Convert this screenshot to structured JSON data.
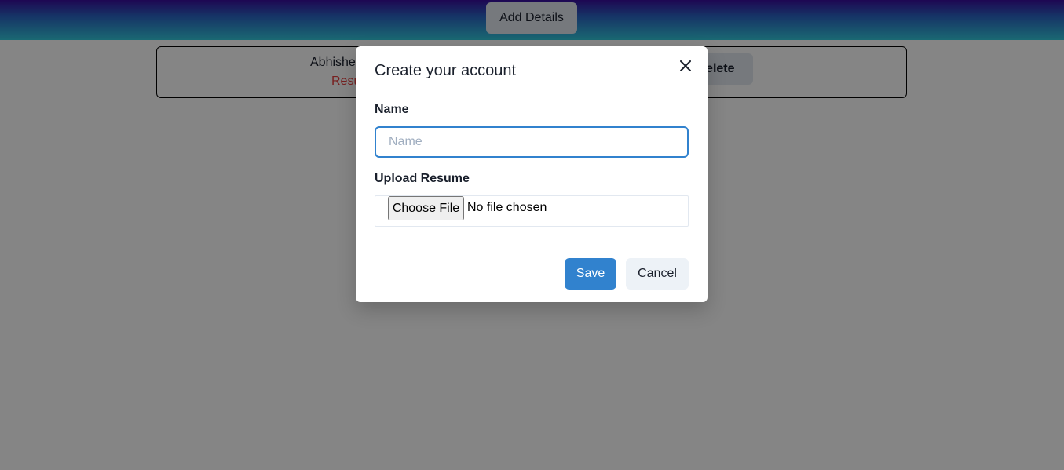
{
  "header": {
    "add_details_label": "Add Details"
  },
  "record": {
    "name": "Abhishek",
    "resume_link": "Resume",
    "delete_label": "Delete"
  },
  "modal": {
    "title": "Create your account",
    "close_icon": "close-icon",
    "name_label": "Name",
    "name_value": "",
    "name_placeholder": "Name",
    "resume_label": "Upload Resume",
    "choose_file_label": "Choose File",
    "file_status": "No file chosen",
    "save_label": "Save",
    "cancel_label": "Cancel"
  },
  "colors": {
    "accent": "#3182ce",
    "link_red": "#e53e3e"
  }
}
